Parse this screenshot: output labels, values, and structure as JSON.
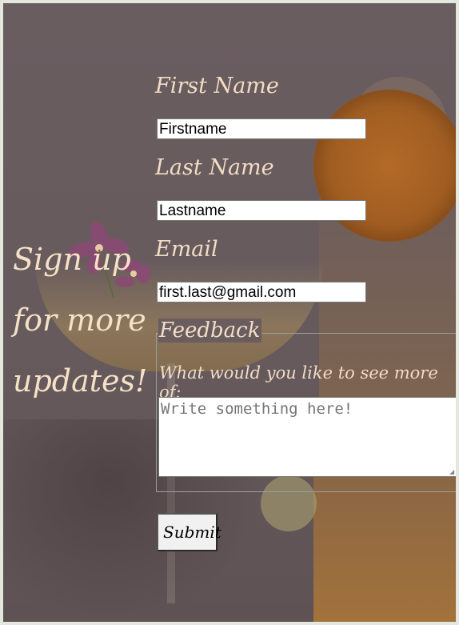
{
  "page": {
    "headline": "Sign up for more updates!"
  },
  "form": {
    "first_name_label": "First Name",
    "first_name_value": "Firstname",
    "last_name_label": "Last Name",
    "last_name_value": "Lastname",
    "email_label": "Email",
    "email_value": "first.last@gmail.com",
    "feedback_legend": "Feedback",
    "feedback_prompt": "What would you like to see more of:",
    "feedback_placeholder": "Write something here!",
    "submit_label": "Submit"
  },
  "colors": {
    "label_text": "#f1dcc4",
    "headline_text": "#f5e1c6",
    "overlay": "#6a5d60"
  }
}
